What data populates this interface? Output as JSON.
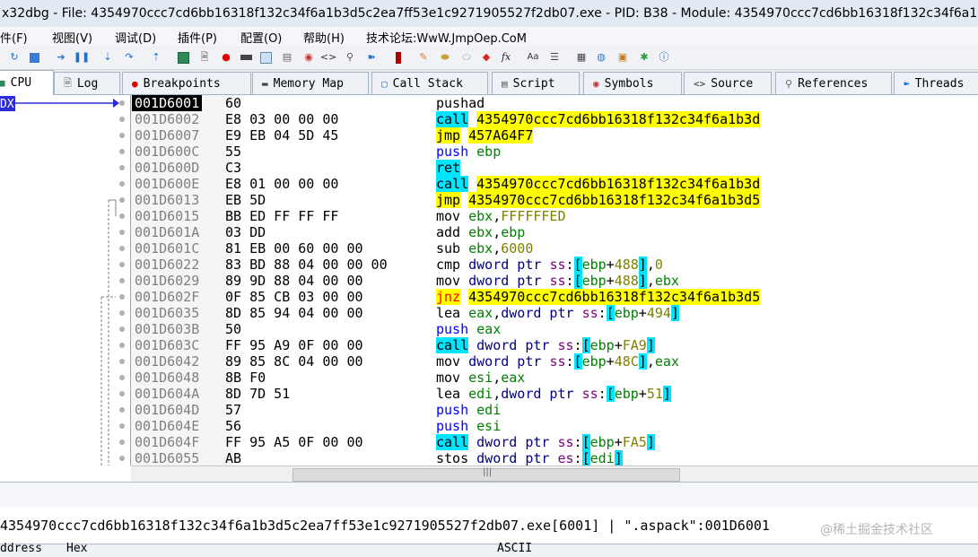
{
  "window": {
    "title": "x32dbg - File: 4354970ccc7cd6bb16318f132c34f6a1b3d5c2ea7ff53e1c9271905527f2db07.exe - PID: B38 - Module: 4354970ccc7cd6bb16318f132c34f6a1b3"
  },
  "menu": [
    {
      "label": "文件(F)"
    },
    {
      "label": "视图(V)"
    },
    {
      "label": "调试(D)"
    },
    {
      "label": "插件(P)"
    },
    {
      "label": "配置(O)"
    },
    {
      "label": "帮助(H)"
    },
    {
      "label": "技术论坛:WwW.JmpOep.CoM"
    }
  ],
  "toolbar_icons": [
    "restart-icon",
    "stop-icon",
    "run-icon",
    "pause-icon",
    "step-into-icon",
    "step-over-icon",
    "execute-till-return-icon",
    "cpu-icon",
    "log-icon",
    "breakpoint-icon",
    "memory-icon",
    "stack-icon",
    "script-icon",
    "symbols-icon",
    "source-icon",
    "references-icon",
    "threads-icon",
    "patches-icon",
    "comments-icon",
    "labels-icon",
    "bookmarks-icon",
    "functions-icon",
    "fx-icon",
    "font-icon",
    "settings-icon",
    "calculator-icon",
    "web-icon",
    "notes-icon",
    "plugin-icon",
    "about-icon"
  ],
  "tabs": [
    {
      "label": "CPU",
      "icon": "cpu-icon"
    },
    {
      "label": "Log",
      "icon": "log-icon"
    },
    {
      "label": "Breakpoints",
      "icon": "breakpoint-icon"
    },
    {
      "label": "Memory Map",
      "icon": "memory-map-icon"
    },
    {
      "label": "Call Stack",
      "icon": "call-stack-icon"
    },
    {
      "label": "Script",
      "icon": "script-icon"
    },
    {
      "label": "Symbols",
      "icon": "symbols-icon"
    },
    {
      "label": "Source",
      "icon": "source-icon"
    },
    {
      "label": "References",
      "icon": "references-icon"
    },
    {
      "label": "Threads",
      "icon": "threads-icon"
    }
  ],
  "eip_label": "DX",
  "disasm": [
    {
      "addr": "001D6001",
      "bytes": "60",
      "mn": "pushad",
      "ops": ""
    },
    {
      "addr": "001D6002",
      "bytes": "E8 03 00 00 00",
      "mn": "call",
      "ops": "4354970ccc7cd6bb16318f132c34f6a1b3d"
    },
    {
      "addr": "001D6007",
      "bytes": "E9 EB 04 5D 45",
      "mn": "jmp",
      "ops": "457A64F7"
    },
    {
      "addr": "001D600C",
      "bytes": "55",
      "mn": "push",
      "ops": "ebp"
    },
    {
      "addr": "001D600D",
      "bytes": "C3",
      "mn": "ret",
      "ops": ""
    },
    {
      "addr": "001D600E",
      "bytes": "E8 01 00 00 00",
      "mn": "call",
      "ops": "4354970ccc7cd6bb16318f132c34f6a1b3d"
    },
    {
      "addr": "001D6013",
      "bytes": "EB 5D",
      "mn": "jmp",
      "ops": "4354970ccc7cd6bb16318f132c34f6a1b3d5"
    },
    {
      "addr": "001D6015",
      "bytes": "BB ED FF FF FF",
      "mn": "mov",
      "ops": "ebx,FFFFFFED"
    },
    {
      "addr": "001D601A",
      "bytes": "03 DD",
      "mn": "add",
      "ops": "ebx,ebp"
    },
    {
      "addr": "001D601C",
      "bytes": "81 EB 00 60 00 00",
      "mn": "sub",
      "ops": "ebx,6000"
    },
    {
      "addr": "001D6022",
      "bytes": "83 BD 88 04 00 00 00",
      "mn": "cmp",
      "ops": "dword ptr ss:[ebp+488],0"
    },
    {
      "addr": "001D6029",
      "bytes": "89 9D 88 04 00 00",
      "mn": "mov",
      "ops": "dword ptr ss:[ebp+488],ebx"
    },
    {
      "addr": "001D602F",
      "bytes": "0F 85 CB 03 00 00",
      "mn": "jnz",
      "ops": "4354970ccc7cd6bb16318f132c34f6a1b3d5"
    },
    {
      "addr": "001D6035",
      "bytes": "8D 85 94 04 00 00",
      "mn": "lea",
      "ops": "eax,dword ptr ss:[ebp+494]"
    },
    {
      "addr": "001D603B",
      "bytes": "50",
      "mn": "push",
      "ops": "eax"
    },
    {
      "addr": "001D603C",
      "bytes": "FF 95 A9 0F 00 00",
      "mn": "call",
      "ops": "dword ptr ss:[ebp+FA9]"
    },
    {
      "addr": "001D6042",
      "bytes": "89 85 8C 04 00 00",
      "mn": "mov",
      "ops": "dword ptr ss:[ebp+48C],eax"
    },
    {
      "addr": "001D6048",
      "bytes": "8B F0",
      "mn": "mov",
      "ops": "esi,eax"
    },
    {
      "addr": "001D604A",
      "bytes": "8D 7D 51",
      "mn": "lea",
      "ops": "edi,dword ptr ss:[ebp+51]"
    },
    {
      "addr": "001D604D",
      "bytes": "57",
      "mn": "push",
      "ops": "edi"
    },
    {
      "addr": "001D604E",
      "bytes": "56",
      "mn": "push",
      "ops": "esi"
    },
    {
      "addr": "001D604F",
      "bytes": "FF 95 A5 0F 00 00",
      "mn": "call",
      "ops": "dword ptr ss:[ebp+FA5]"
    },
    {
      "addr": "001D6055",
      "bytes": "AB",
      "mn": "stos",
      "ops": "dword ptr es:[edi]"
    }
  ],
  "status_line": "4354970ccc7cd6bb16318f132c34f6a1b3d5c2ea7ff53e1c9271905527f2db07.exe[6001] | \".aspack\":001D6001",
  "watermark": "@稀土掘金技术社区",
  "dump_headers": [
    "ddress",
    "Hex",
    "ASCII"
  ]
}
